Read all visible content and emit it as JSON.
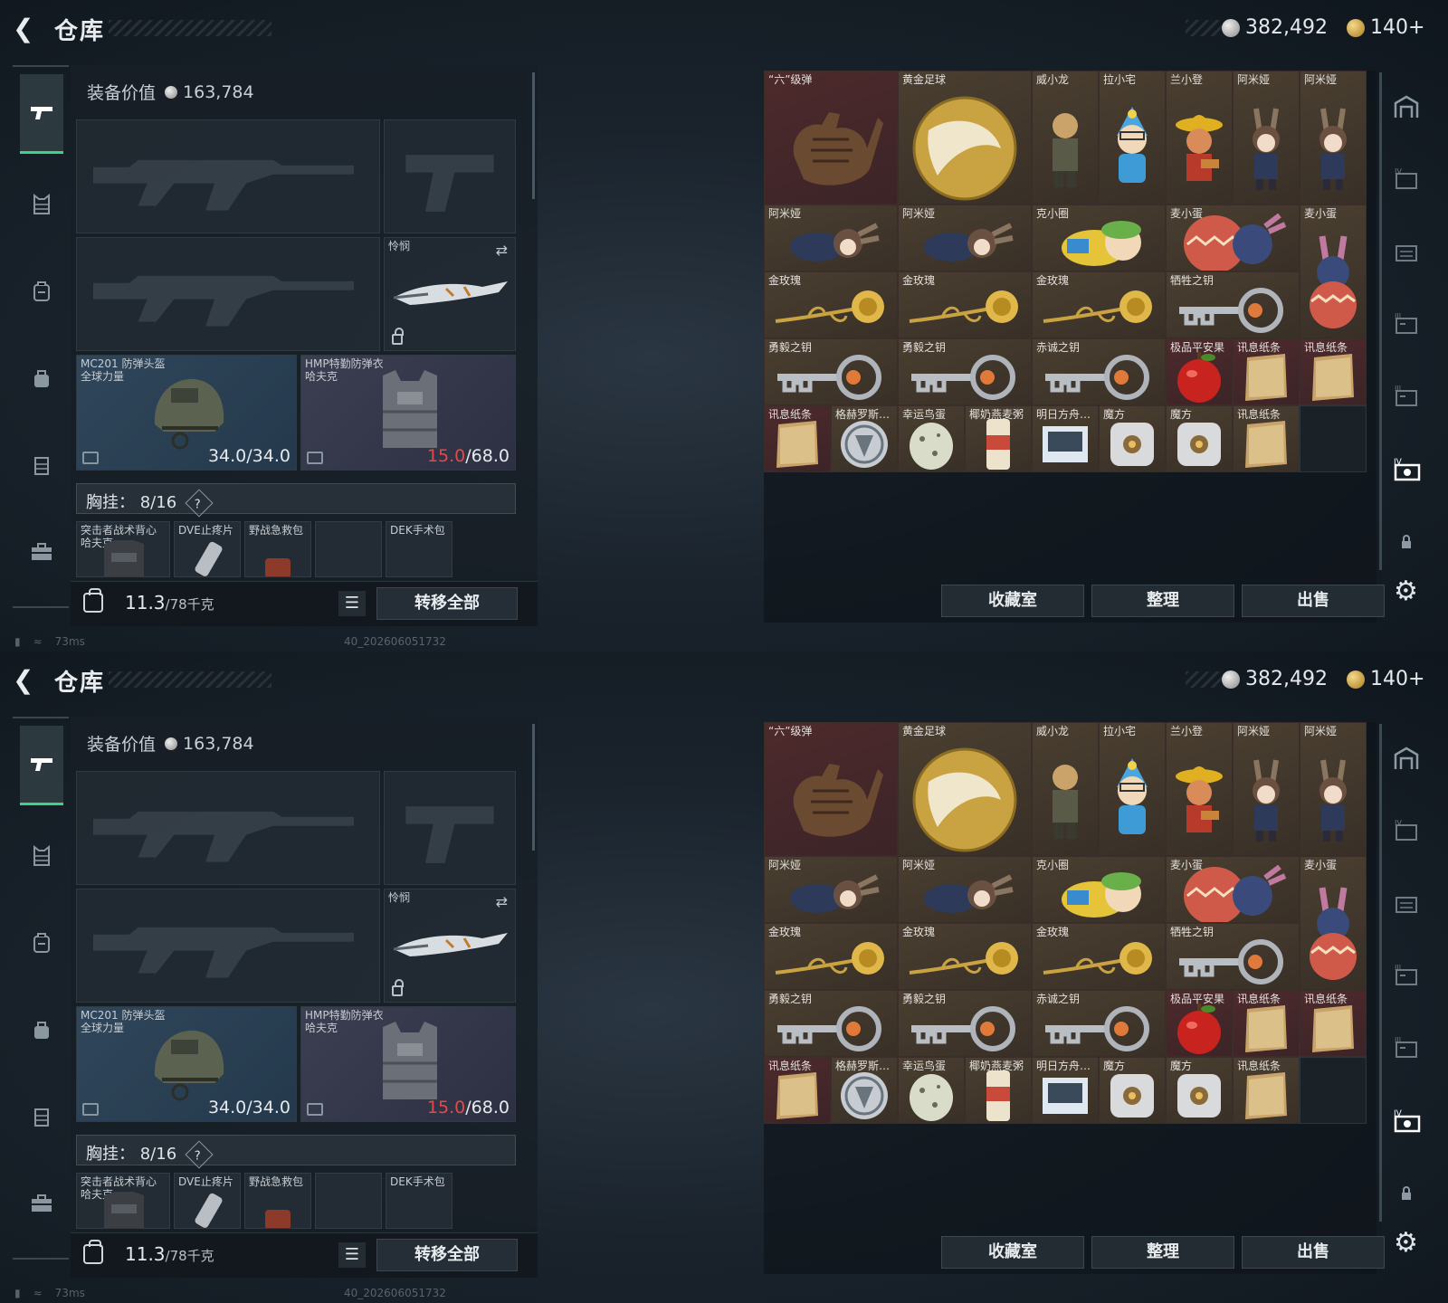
{
  "header": {
    "title": "仓库",
    "silver": "382,492",
    "gold": "140+"
  },
  "equipment": {
    "value_label": "装备价值",
    "value": "163,784",
    "melee_label": "怜悯",
    "helmet": {
      "name": "MC201 防弹头盔",
      "sub": "全球力量",
      "dura": "34.0",
      "max": "/34.0"
    },
    "vest": {
      "name": "HMP特勤防弹衣",
      "sub": "哈夫克",
      "dura": "15.0",
      "max": "/68.0"
    },
    "chest_label": "胸挂：",
    "chest_count": "8/16",
    "chest_q": "?",
    "rig_items": [
      "突击者战术背心\n哈夫克",
      "DVE止疼片",
      "野战急救包",
      "",
      "DEK手术包"
    ],
    "weight": "11.3",
    "weight_max": "/78千克",
    "transfer_all": "转移全部"
  },
  "inventory": {
    "cells": [
      {
        "label": "“六”级弹",
        "art": "hand",
        "tone": "red"
      },
      {
        "label": "黄金足球",
        "art": "ball",
        "tone": "gold"
      },
      {
        "label": "威小龙",
        "art": "fig1",
        "tone": "gold"
      },
      {
        "label": "拉小宅",
        "art": "fig2",
        "tone": "gold"
      },
      {
        "label": "兰小登",
        "art": "fig3",
        "tone": "gold"
      },
      {
        "label": "阿米娅",
        "art": "fig4",
        "tone": "gold"
      },
      {
        "label": "阿米娅",
        "art": "fig4",
        "tone": "gold"
      },
      {
        "label": "阿米娅",
        "art": "lie",
        "tone": "gold"
      },
      {
        "label": "阿米娅",
        "art": "lie",
        "tone": "gold"
      },
      {
        "label": "克小圈",
        "art": "lie2",
        "tone": "gold"
      },
      {
        "label": "麦小蛋",
        "art": "egg",
        "tone": "gold"
      },
      {
        "label": "麦小蛋",
        "art": "egg2",
        "tone": "gold"
      },
      {
        "label": "金玫瑰",
        "art": "rose",
        "tone": "gold"
      },
      {
        "label": "金玫瑰",
        "art": "rose",
        "tone": "gold"
      },
      {
        "label": "金玫瑰",
        "art": "rose",
        "tone": "gold"
      },
      {
        "label": "牺牲之钥",
        "art": "key",
        "tone": "gold"
      },
      {
        "label": "勇毅之钥",
        "art": "key",
        "tone": "gold"
      },
      {
        "label": "勇毅之钥",
        "art": "key",
        "tone": "gold"
      },
      {
        "label": "赤诚之钥",
        "art": "key",
        "tone": "gold"
      },
      {
        "label": "极品平安果",
        "art": "apple",
        "tone": "red"
      },
      {
        "label": "讯息纸条",
        "art": "paper",
        "tone": "red"
      },
      {
        "label": "讯息纸条",
        "art": "paper",
        "tone": "red"
      },
      {
        "label": "讯息纸条",
        "art": "paper",
        "tone": "red"
      },
      {
        "label": "格赫罗斯…",
        "art": "coin",
        "tone": "gold"
      },
      {
        "label": "幸运鸟蛋",
        "art": "egg3",
        "tone": "gold"
      },
      {
        "label": "椰奶燕麦粥",
        "art": "can",
        "tone": "gold"
      },
      {
        "label": "明日方舟…",
        "art": "card",
        "tone": "gold"
      },
      {
        "label": "魔方",
        "art": "cube",
        "tone": "gold"
      },
      {
        "label": "魔方",
        "art": "cube",
        "tone": "gold"
      },
      {
        "label": "讯息纸条",
        "art": "paper",
        "tone": "gold"
      },
      {
        "label": "",
        "art": "",
        "tone": "empty"
      }
    ],
    "btn_collection": "收藏室",
    "btn_sort": "整理",
    "btn_sell": "出售"
  },
  "status": {
    "ping": "73ms",
    "uid": "40_202606051732"
  },
  "colors": {
    "accent": "#3fd18a",
    "red_value": "#e24a4a"
  }
}
